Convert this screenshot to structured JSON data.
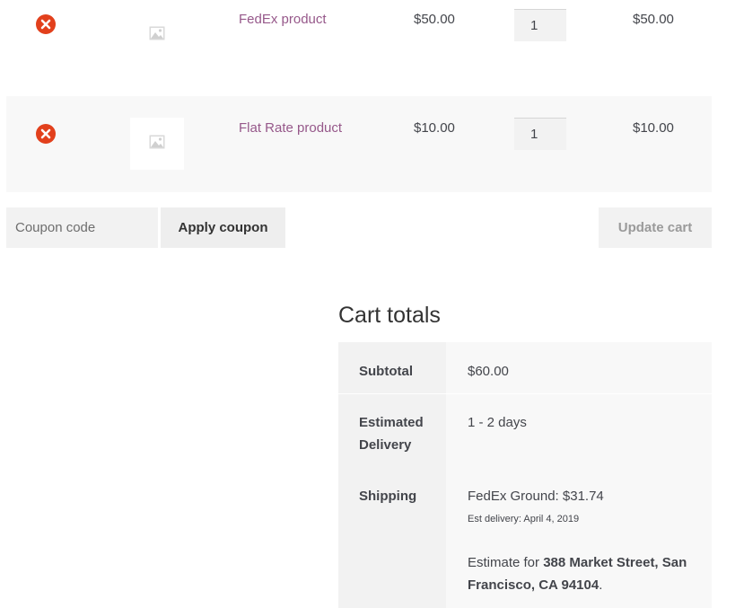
{
  "cart": {
    "items": [
      {
        "name": "FedEx product",
        "price": "$50.00",
        "quantity": "1",
        "subtotal": "$50.00"
      },
      {
        "name": "Flat Rate product",
        "price": "$10.00",
        "quantity": "1",
        "subtotal": "$10.00"
      }
    ],
    "icons": {
      "remove": "remove-icon",
      "thumbnail": "image-placeholder-icon"
    }
  },
  "actions": {
    "coupon_placeholder": "Coupon code",
    "apply_label": "Apply coupon",
    "update_label": "Update cart"
  },
  "totals": {
    "title": "Cart totals",
    "subtotal_label": "Subtotal",
    "subtotal_value": "$60.00",
    "delivery_label": "Estimated Delivery",
    "delivery_value": "1 - 2 days",
    "shipping_label": "Shipping",
    "shipping_method": "FedEx Ground: $31.74",
    "shipping_est": "Est delivery: April 4, 2019",
    "estimate_prefix": "Estimate for",
    "estimate_address": "388 Market Street, San Francisco, CA 94104",
    "estimate_suffix": "."
  },
  "colors": {
    "link": "#96588a",
    "remove": "#e2401c",
    "text": "#43454b"
  }
}
